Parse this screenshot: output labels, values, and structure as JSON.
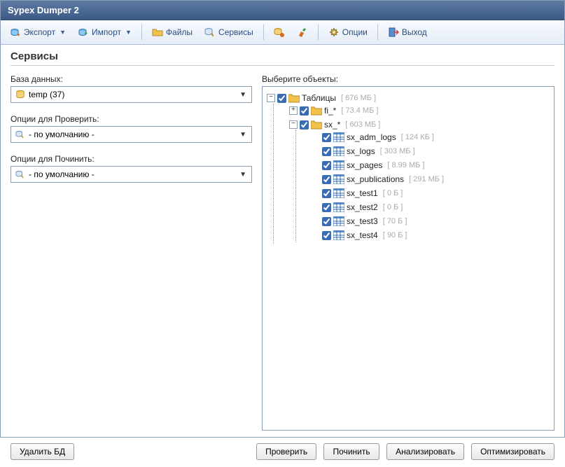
{
  "window_title": "Sypex Dumper 2",
  "toolbar": {
    "export": "Экспорт",
    "import": "Импорт",
    "files": "Файлы",
    "services": "Сервисы",
    "options": "Опции",
    "exit": "Выход"
  },
  "page_title": "Сервисы",
  "left": {
    "db_label": "База данных:",
    "db_value": "temp (37)",
    "check_opts_label": "Опции для Проверить:",
    "check_opts_value": "- по умолчанию -",
    "repair_opts_label": "Опции для Починить:",
    "repair_opts_value": "- по умолчанию -"
  },
  "right": {
    "objects_label": "Выберите объекты:"
  },
  "tree": {
    "root": {
      "label": "Таблицы",
      "size": "[ 676 МБ ]"
    },
    "fi": {
      "label": "fi_*",
      "size": "[ 73.4 МБ ]"
    },
    "sx": {
      "label": "sx_*",
      "size": "[ 603 МБ ]"
    },
    "items": [
      {
        "label": "sx_adm_logs",
        "size": "[ 124 КБ ]"
      },
      {
        "label": "sx_logs",
        "size": "[ 303 МБ ]"
      },
      {
        "label": "sx_pages",
        "size": "[ 8.99 МБ ]"
      },
      {
        "label": "sx_publications",
        "size": "[ 291 МБ ]"
      },
      {
        "label": "sx_test1",
        "size": "[ 0 Б ]"
      },
      {
        "label": "sx_test2",
        "size": "[ 0 Б ]"
      },
      {
        "label": "sx_test3",
        "size": "[ 70 Б ]"
      },
      {
        "label": "sx_test4",
        "size": "[ 90 Б ]"
      }
    ]
  },
  "buttons": {
    "delete_db": "Удалить БД",
    "check": "Проверить",
    "repair": "Починить",
    "analyze": "Анализировать",
    "optimize": "Оптимизировать"
  }
}
